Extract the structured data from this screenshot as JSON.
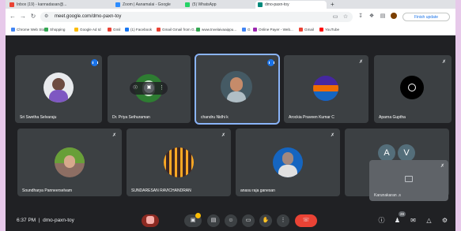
{
  "browser": {
    "tabs": [
      {
        "label": "Inbox (19) - kannadasan@..."
      },
      {
        "label": "Zoom | Aanamalai - Google"
      },
      {
        "label": "(5) WhatsApp"
      },
      {
        "label": "dmo-paxn-toy"
      }
    ],
    "new_tab": "+",
    "url": "meet.google.com/dmo-paxn-toy",
    "finish_update": "Finish update",
    "bookmarks": [
      {
        "label": "Chrome Web Store",
        "color": "#4285f4"
      },
      {
        "label": "Shopping",
        "color": "#34a853"
      },
      {
        "label": "Google Ad Id",
        "color": "#fbbc04"
      },
      {
        "label": "Gmil",
        "color": "#ea4335"
      },
      {
        "label": "(1) Facebook",
        "color": "#1877f2"
      },
      {
        "label": "Gmail Gmail from G...",
        "color": "#ea4335"
      },
      {
        "label": "www.tnvelaivaaippu...",
        "color": "#34a853"
      },
      {
        "label": "G",
        "color": "#4285f4"
      },
      {
        "label": "Online Payer - Web...",
        "color": "#9c27b0"
      },
      {
        "label": "Gmail",
        "color": "#ea4335"
      },
      {
        "label": "YouTube",
        "color": "#ff0000"
      }
    ]
  },
  "participants_row1": [
    {
      "name": "Sri Swetha Selvaraju",
      "speaking": true
    },
    {
      "name": "Dr. Priya Sethuraman",
      "speaking": false
    },
    {
      "name": "chandru Nidhi k",
      "speaking": true
    },
    {
      "name": "Arockia Praveen Kumar C",
      "speaking": false
    },
    {
      "name": "Aparna Guptha",
      "speaking": false
    }
  ],
  "participants_row2": [
    {
      "name": "Soundharya Panneerselvam"
    },
    {
      "name": "SUNDARESAN RAVICHANDRAN"
    },
    {
      "name": "anasu raja ganesan"
    },
    {
      "name": ""
    }
  ],
  "self_view": {
    "name": "Karunakaran .s"
  },
  "overflow_initials": [
    "A",
    "V"
  ],
  "bottom": {
    "time": "6:37 PM",
    "meeting_code": "dmo-paxn-toy",
    "participant_count": "28"
  },
  "colors": {
    "background": "#202124",
    "tile": "#3c4043",
    "accent": "#1a73e8",
    "end_call": "#ea4335"
  }
}
